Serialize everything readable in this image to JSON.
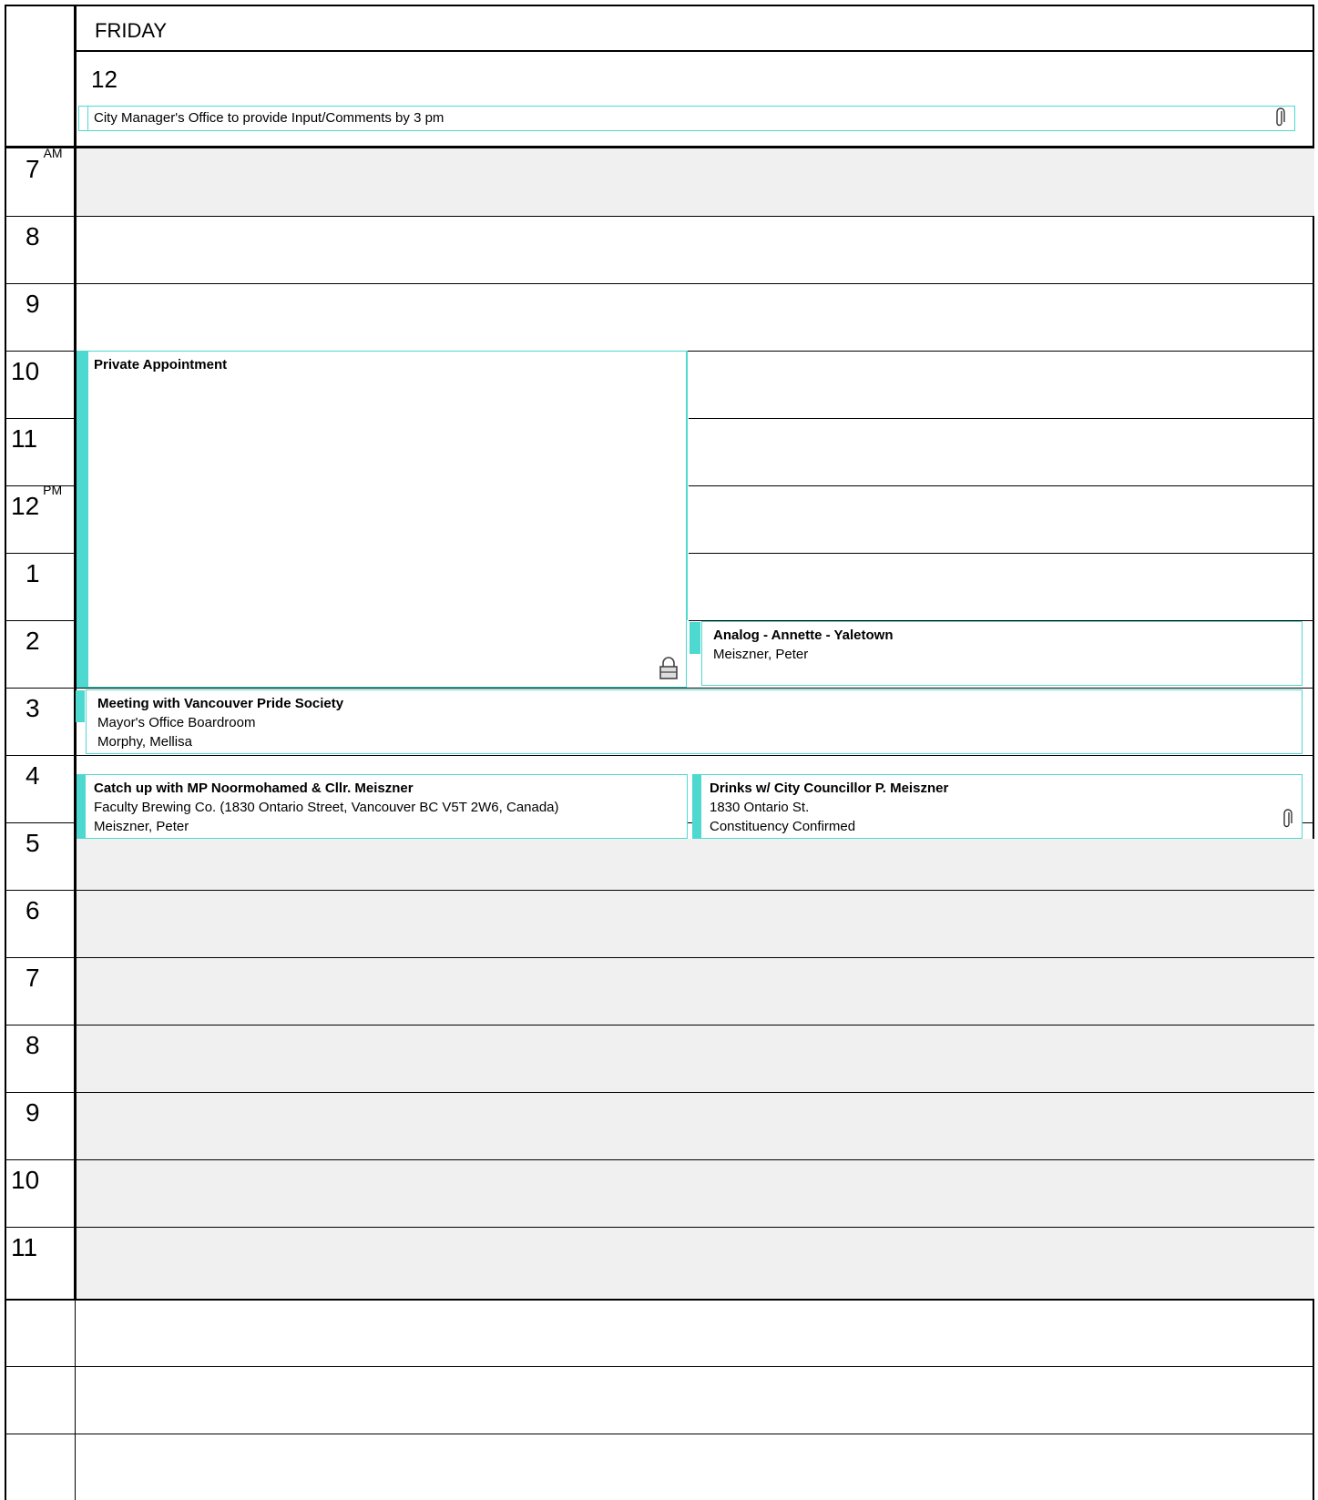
{
  "header": {
    "weekday": "FRIDAY",
    "day_number": "12"
  },
  "all_day_event": {
    "title": "City Manager's Office to provide Input/Comments by 3 pm",
    "icon": "paperclip-icon"
  },
  "hours": [
    {
      "label": "7",
      "suffix": "AM"
    },
    {
      "label": "8",
      "suffix": ""
    },
    {
      "label": "9",
      "suffix": ""
    },
    {
      "label": "10",
      "suffix": ""
    },
    {
      "label": "11",
      "suffix": ""
    },
    {
      "label": "12",
      "suffix": "PM"
    },
    {
      "label": "1",
      "suffix": ""
    },
    {
      "label": "2",
      "suffix": ""
    },
    {
      "label": "3",
      "suffix": ""
    },
    {
      "label": "4",
      "suffix": ""
    },
    {
      "label": "5",
      "suffix": ""
    },
    {
      "label": "6",
      "suffix": ""
    },
    {
      "label": "7",
      "suffix": ""
    },
    {
      "label": "8",
      "suffix": ""
    },
    {
      "label": "9",
      "suffix": ""
    },
    {
      "label": "10",
      "suffix": ""
    },
    {
      "label": "11",
      "suffix": ""
    }
  ],
  "events": {
    "private": {
      "title": "Private Appointment",
      "icon": "lock-icon"
    },
    "analog": {
      "title": "Analog - Annette - Yaletown",
      "line1": "Meiszner, Peter"
    },
    "pride": {
      "title": "Meeting with Vancouver Pride Society",
      "line1": "Mayor's Office Boardroom",
      "line2": "Morphy, Mellisa"
    },
    "catchup": {
      "title": "Catch up with MP Noormohamed & Cllr. Meiszner",
      "line1": "Faculty Brewing Co. (1830 Ontario Street, Vancouver BC V5T 2W6, Canada)",
      "line2": "Meiszner, Peter"
    },
    "drinks": {
      "title": "Drinks w/ City Councillor P. Meiszner",
      "line1": "1830 Ontario St.",
      "line2": "Constituency Confirmed",
      "icon": "paperclip-icon"
    }
  },
  "colors": {
    "accent": "#4dd9cf",
    "off_hours_bg": "#f0f0f0",
    "border": "#000000"
  }
}
